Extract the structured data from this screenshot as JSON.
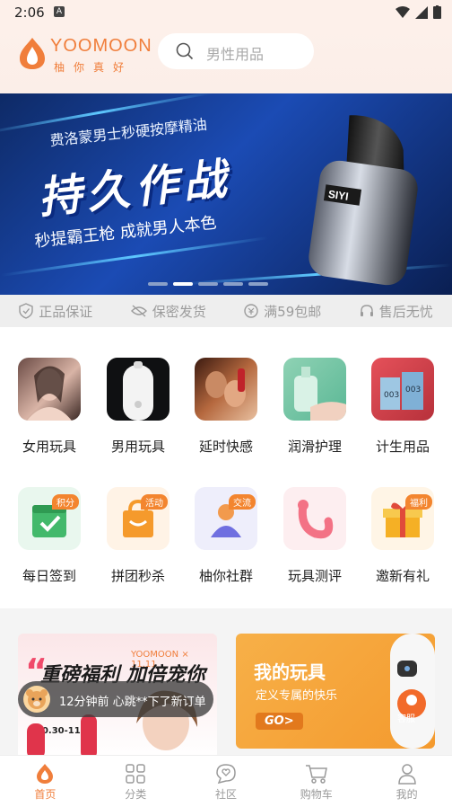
{
  "status_bar": {
    "time": "2:06",
    "notification_icon": "A"
  },
  "header": {
    "logo_word": "YOOMOON",
    "logo_sub": "柚你真好",
    "search_placeholder": "男性用品"
  },
  "banner": {
    "subline": "费洛蒙男士秒硬按摩精油",
    "headline": "持久作战",
    "tagline": "秒提霸王枪 成就男人本色",
    "product_label": "SIYI",
    "slide_count": 5,
    "active_slide": 2
  },
  "guarantees": [
    {
      "icon": "shield-check-icon",
      "label": "正品保证"
    },
    {
      "icon": "eye-off-icon",
      "label": "保密发货"
    },
    {
      "icon": "coin-icon",
      "label": "满59包邮"
    },
    {
      "icon": "headset-icon",
      "label": "售后无忧"
    }
  ],
  "categories": [
    {
      "label": "女用玩具",
      "icon": "female-toys-image"
    },
    {
      "label": "男用玩具",
      "icon": "male-toys-image"
    },
    {
      "label": "延时快感",
      "icon": "delay-image"
    },
    {
      "label": "润滑护理",
      "icon": "lubricant-image"
    },
    {
      "label": "计生用品",
      "icon": "contraceptive-image"
    }
  ],
  "activities": [
    {
      "label": "每日签到",
      "badge": "积分",
      "icon": "calendar-check-icon"
    },
    {
      "label": "拼团秒杀",
      "badge": "活动",
      "icon": "shopping-bag-icon"
    },
    {
      "label": "柚你社群",
      "badge": "交流",
      "icon": "community-user-icon"
    },
    {
      "label": "玩具测评",
      "badge": "",
      "icon": "toy-review-icon"
    },
    {
      "label": "邀新有礼",
      "badge": "福利",
      "icon": "gift-box-icon"
    }
  ],
  "promos": {
    "left": {
      "brand": "YOOMOON × 11.11",
      "headline": "重磅福利 加倍宠你",
      "dates": "10.30-11.20"
    },
    "right": {
      "title": "我的玩具",
      "subtitle": "定义专属的快乐",
      "cta": "GO>",
      "service_label": "客服"
    }
  },
  "toast": {
    "message": "12分钟前 心跳**下了新订单"
  },
  "tabbar": [
    {
      "label": "首页",
      "icon": "home-icon",
      "active": true
    },
    {
      "label": "分类",
      "icon": "grid-icon",
      "active": false
    },
    {
      "label": "社区",
      "icon": "community-icon",
      "active": false
    },
    {
      "label": "购物车",
      "icon": "cart-icon",
      "active": false
    },
    {
      "label": "我的",
      "icon": "user-icon",
      "active": false
    }
  ],
  "colors": {
    "brand": "#f07e3b",
    "banner_blue": "#1b4bb4"
  }
}
